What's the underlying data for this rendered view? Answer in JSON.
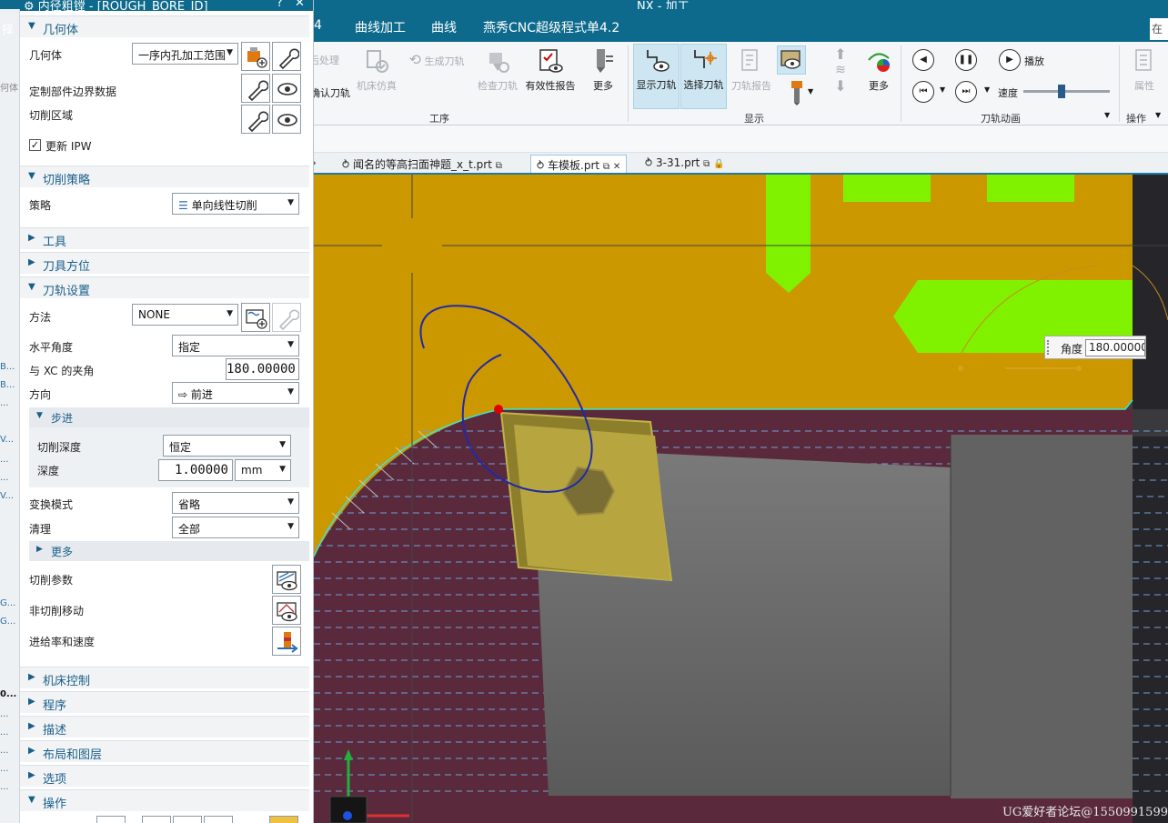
{
  "app": {
    "title": "NX - 加工"
  },
  "menubar": {
    "items": [
      "4",
      "曲线加工",
      "曲线",
      "燕秀CNC超级程式单4.2"
    ],
    "search_stub": "在"
  },
  "ribbon": {
    "buttons": {
      "post_process": "后处理",
      "confirm_path": "确认刀轨",
      "machine_sim": "机床仿真",
      "generate_path": "生成刀轨",
      "check_path": "检查刀轨",
      "validity_report": "有效性报告",
      "more1": "更多",
      "show_path": "显示刀轨",
      "select_path": "选择刀轨",
      "path_report": "刀轨报告",
      "more2": "更多",
      "play": "播放",
      "speed": "速度",
      "properties": "属性"
    },
    "groups": {
      "operation": "工序",
      "display": "显示",
      "animation": "刀轨动画",
      "actions": "操作"
    }
  },
  "file_tabs": [
    {
      "label": "闻名的等高扫面神题_x_t.prt",
      "active": false
    },
    {
      "label": "车模板.prt",
      "active": true
    },
    {
      "label": "3-31.prt",
      "active": false
    }
  ],
  "leftnav": {
    "top_label": "择",
    "mid_label": "何体",
    "fragments": [
      "B...",
      "B...",
      "...",
      "V...",
      "...",
      "...",
      "V...",
      "G...",
      "G...",
      "0...",
      "...",
      "...",
      "...",
      "...",
      "..."
    ]
  },
  "dialog": {
    "title": "内径粗镗 - [ROUGH_BORE_ID]",
    "help": "?",
    "close": "✕",
    "sections": {
      "geometry": {
        "title": "几何体",
        "geometry_label": "几何体",
        "geometry_value": "一序内孔加工范围",
        "custom_boundary_label": "定制部件边界数据",
        "cut_region_label": "切削区域",
        "update_ipw_label": "更新 IPW",
        "update_ipw_checked": true
      },
      "strategy": {
        "title": "切削策略",
        "strategy_label": "策略",
        "strategy_value": "单向线性切削"
      },
      "tool": {
        "title": "工具"
      },
      "tool_orientation": {
        "title": "刀具方位"
      },
      "path_settings": {
        "title": "刀轨设置",
        "method_label": "方法",
        "method_value": "NONE",
        "level_angle_label": "水平角度",
        "level_angle_value": "指定",
        "xc_angle_label": "与 XC 的夹角",
        "xc_angle_value": "180.00000",
        "direction_label": "方向",
        "direction_value": "前进",
        "stepover": {
          "title": "步进",
          "cut_depth_label": "切削深度",
          "cut_depth_value": "恒定",
          "depth_label": "深度",
          "depth_value": "1.00000",
          "depth_unit": "mm"
        },
        "transform_mode_label": "变换模式",
        "transform_mode_value": "省略",
        "cleanup_label": "清理",
        "cleanup_value": "全部",
        "more_title": "更多",
        "cut_params_label": "切削参数",
        "non_cut_moves_label": "非切削移动",
        "feeds_speeds_label": "进给率和速度"
      },
      "machine_control": {
        "title": "机床控制"
      },
      "program": {
        "title": "程序"
      },
      "description": {
        "title": "描述"
      },
      "layout_layers": {
        "title": "布局和图层"
      },
      "options": {
        "title": "选项"
      },
      "actions": {
        "title": "操作"
      }
    }
  },
  "viewport": {
    "angle_label": "角度",
    "angle_value": "180.00000",
    "watermark": "UG爱好者论坛@1550991599"
  },
  "colors": {
    "title_bar": "#0d6a8c",
    "part_orange": "#cc9800",
    "stock_maroon": "#5a2a3c",
    "feature_green": "#80f200",
    "tool_gray": "#6e6e6e",
    "insert_yellow": "#b7a640",
    "sketch_blue": "#1f2aa8",
    "section_text": "#1a5f8a"
  }
}
